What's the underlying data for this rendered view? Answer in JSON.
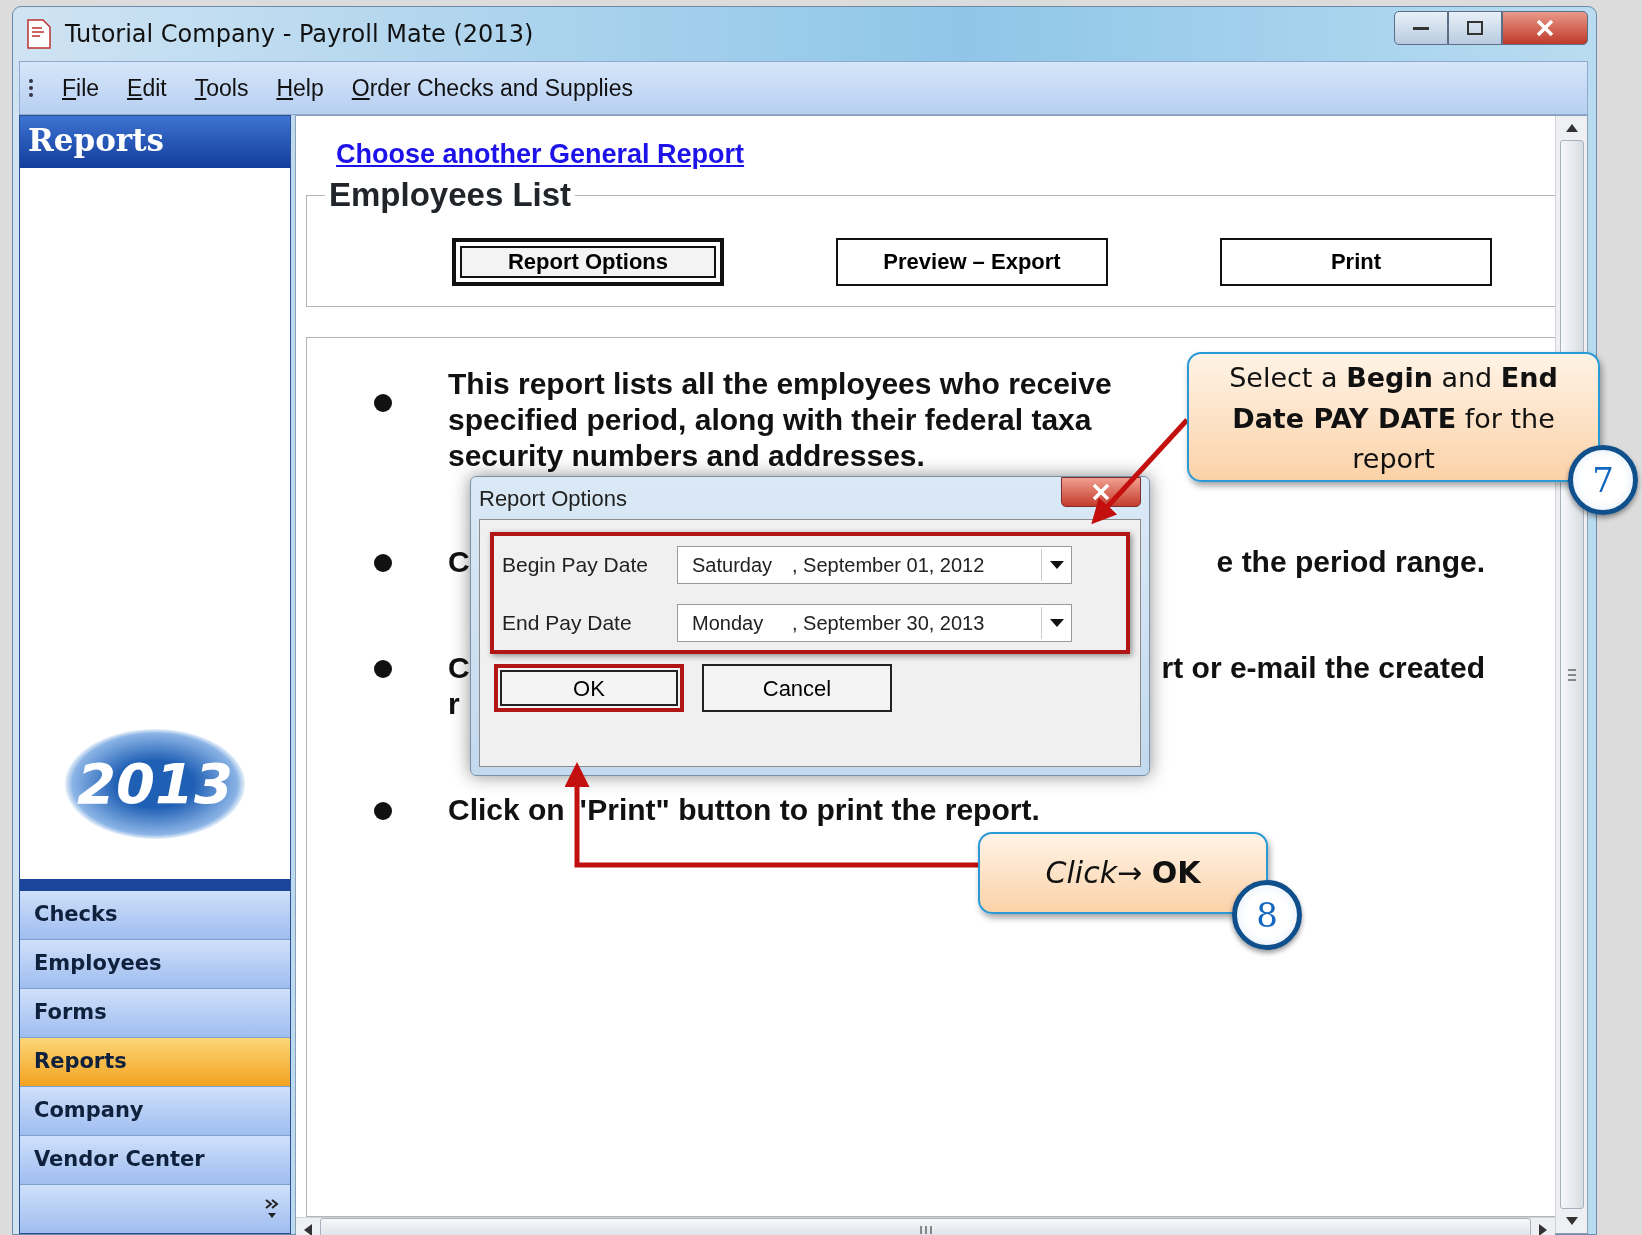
{
  "window": {
    "title": "Tutorial Company - Payroll Mate (2013)"
  },
  "menu": [
    {
      "label": "File"
    },
    {
      "label": "Edit"
    },
    {
      "label": "Tools"
    },
    {
      "label": "Help"
    },
    {
      "label": "Order Checks and Supplies"
    }
  ],
  "sidebar": {
    "header": "Reports",
    "logo": "2013",
    "items": [
      {
        "label": "Checks",
        "selected": false
      },
      {
        "label": "Employees",
        "selected": false
      },
      {
        "label": "Forms",
        "selected": false
      },
      {
        "label": "Reports",
        "selected": true
      },
      {
        "label": "Company",
        "selected": false
      },
      {
        "label": "Vendor Center",
        "selected": false
      }
    ]
  },
  "report": {
    "link": "Choose another General Report",
    "group_title": "Employees List",
    "buttons": [
      {
        "label": "Report Options",
        "focused": true
      },
      {
        "label": "Preview – Export",
        "focused": false
      },
      {
        "label": "Print",
        "focused": false
      }
    ],
    "bullets": [
      {
        "lines": [
          {
            "text": "This report lists all the employees who receive"
          },
          {
            "text": "specified period, along with their federal taxa"
          },
          {
            "text": "security numbers and addresses."
          }
        ]
      },
      {
        "lines": [
          {
            "text": "C",
            "right": "e the period range."
          }
        ]
      },
      {
        "lines": [
          {
            "text": "C",
            "right": "rt or e-mail the created"
          },
          {
            "text": "r"
          }
        ]
      },
      {
        "lines": [
          {
            "text": "Click on \"Print\" button to print the report."
          }
        ]
      }
    ]
  },
  "dialog": {
    "title": "Report Options",
    "fields_highlighted": true,
    "fields": [
      {
        "label": "Begin Pay Date",
        "day": "Saturday",
        "date": ", September 01, 2012"
      },
      {
        "label": "End Pay Date",
        "day": "Monday",
        "date": ", September 30, 2013"
      }
    ],
    "buttons": [
      {
        "label": "OK",
        "highlighted": true
      },
      {
        "label": "Cancel",
        "highlighted": false
      }
    ]
  },
  "callouts": [
    {
      "text": "Select a **Begin** and **End Date PAY DATE** for the report",
      "step": "7"
    },
    {
      "text": "*Click*→ **OK**",
      "step": "8"
    }
  ]
}
